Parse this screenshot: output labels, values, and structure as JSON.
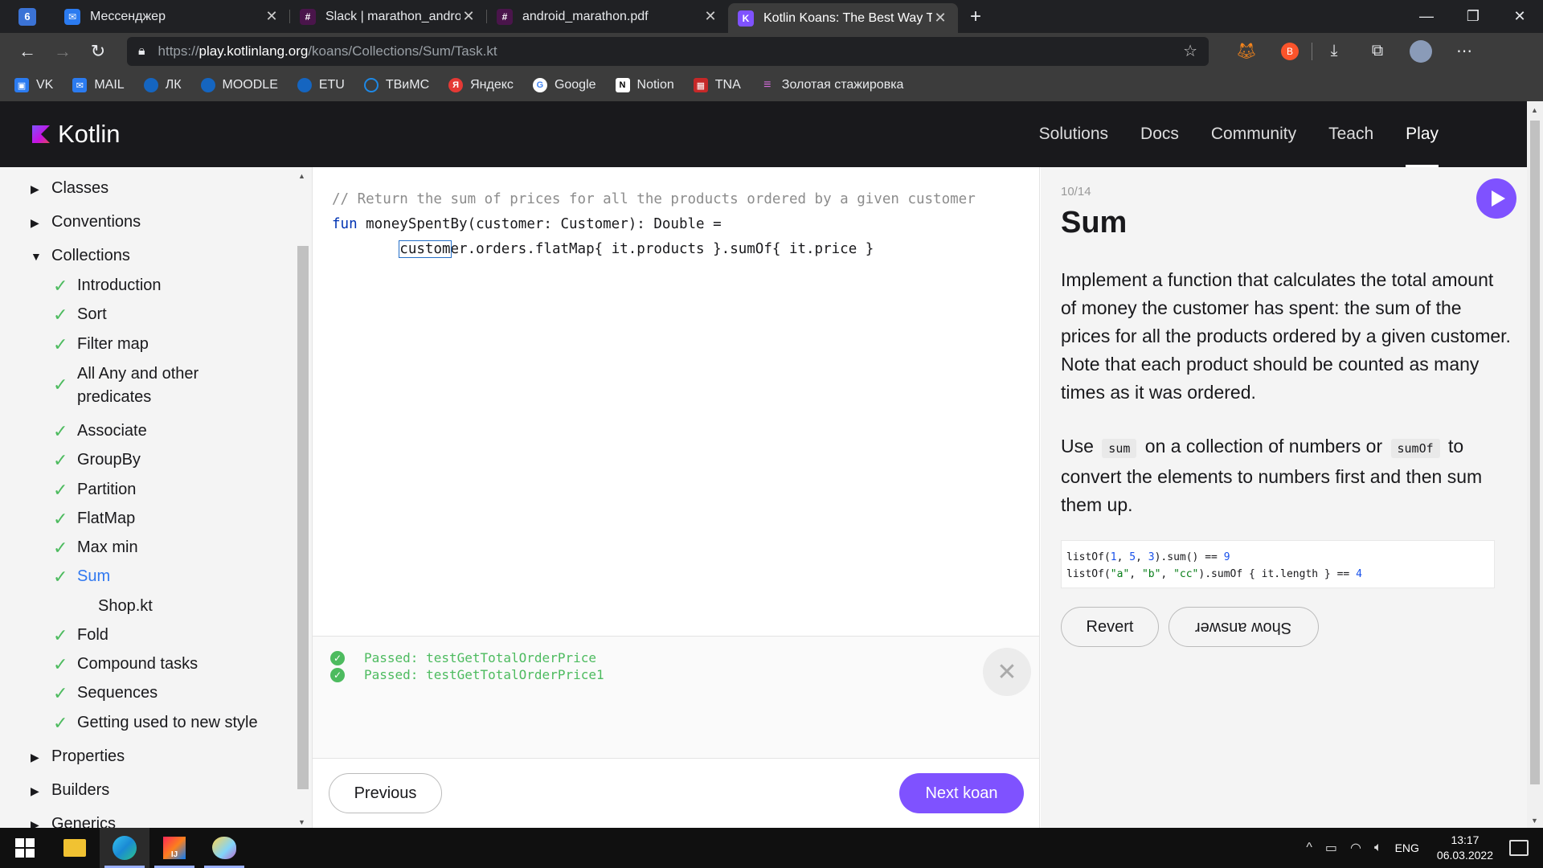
{
  "browser": {
    "tabs": [
      {
        "title": "Мессенджер",
        "icon": "messenger-icon",
        "color": "#2b7bf0",
        "active": false
      },
      {
        "title": "Slack | marathon_android | Vibelab",
        "icon": "slack-icon",
        "color": "#e01e5a",
        "active": false
      },
      {
        "title": "android_marathon.pdf",
        "icon": "slack-icon",
        "color": "#e01e5a",
        "active": false
      },
      {
        "title": "Kotlin Koans: The Best Way To Learn Kotlin",
        "icon": "kotlin-icon",
        "color": "#7f52ff",
        "active": true
      }
    ],
    "url_prefix": "https://",
    "url_host": "play.kotlinlang.org",
    "url_path": "/koans/Collections/Sum/Task.kt",
    "bookmarks": [
      {
        "label": "VK",
        "color": "#2b7bf0"
      },
      {
        "label": "MAIL",
        "color": "#2b7bf0"
      },
      {
        "label": "ЛК",
        "color": "#1565c0"
      },
      {
        "label": "MOODLE",
        "color": "#1565c0"
      },
      {
        "label": "ETU",
        "color": "#1565c0"
      },
      {
        "label": "ТВиМС",
        "color": "#1e88e5"
      },
      {
        "label": "Яндекс",
        "color": "#e53935"
      },
      {
        "label": "Google",
        "color": "#ffffff"
      },
      {
        "label": "Notion",
        "color": "#ffffff"
      },
      {
        "label": "TNA",
        "color": "#c62828"
      },
      {
        "label": "Золотая стажировка",
        "color": "#d26bd8"
      }
    ]
  },
  "site": {
    "logo": "Kotlin",
    "nav": [
      {
        "label": "Solutions",
        "active": false
      },
      {
        "label": "Docs",
        "active": false
      },
      {
        "label": "Community",
        "active": false
      },
      {
        "label": "Teach",
        "active": false
      },
      {
        "label": "Play",
        "active": true
      }
    ]
  },
  "sidebar": {
    "items": [
      {
        "label": "Classes",
        "kind": "section",
        "state": "collapsed"
      },
      {
        "label": "Conventions",
        "kind": "section",
        "state": "collapsed"
      },
      {
        "label": "Collections",
        "kind": "section",
        "state": "expanded"
      },
      {
        "label": "Introduction",
        "kind": "koan",
        "done": true
      },
      {
        "label": "Sort",
        "kind": "koan",
        "done": true
      },
      {
        "label": "Filter map",
        "kind": "koan",
        "done": true
      },
      {
        "label": "All Any and other predicates",
        "kind": "koan",
        "done": true
      },
      {
        "label": "Associate",
        "kind": "koan",
        "done": true
      },
      {
        "label": "GroupBy",
        "kind": "koan",
        "done": true
      },
      {
        "label": "Partition",
        "kind": "koan",
        "done": true
      },
      {
        "label": "FlatMap",
        "kind": "koan",
        "done": true
      },
      {
        "label": "Max min",
        "kind": "koan",
        "done": true
      },
      {
        "label": "Sum",
        "kind": "koan",
        "done": true,
        "current": true
      },
      {
        "label": "Shop.kt",
        "kind": "file"
      },
      {
        "label": "Fold",
        "kind": "koan",
        "done": true
      },
      {
        "label": "Compound tasks",
        "kind": "koan",
        "done": true
      },
      {
        "label": "Sequences",
        "kind": "koan",
        "done": true
      },
      {
        "label": "Getting used to new style",
        "kind": "koan",
        "done": true
      },
      {
        "label": "Properties",
        "kind": "section",
        "state": "collapsed"
      },
      {
        "label": "Builders",
        "kind": "section",
        "state": "collapsed"
      },
      {
        "label": "Generics",
        "kind": "section",
        "state": "collapsed"
      }
    ]
  },
  "editor": {
    "comment": "// Return the sum of prices for all the products ordered by a given customer",
    "line2_kw": "fun",
    "line2_rest": " moneySpentBy(customer: Customer): Double =",
    "line3_sel": "custom",
    "line3_rest": "er.orders.flatMap{ it.products }.sumOf{ it.price }"
  },
  "results": [
    "Passed: testGetTotalOrderPrice",
    "Passed: testGetTotalOrderPrice1"
  ],
  "footer": {
    "previous": "Previous",
    "next": "Next koan"
  },
  "task": {
    "counter": "10/14",
    "title": "Sum",
    "description": "Implement a function that calculates the total amount of money the customer has spent: the sum of the prices for all the products ordered by a given customer. Note that each product should be counted as many times as it was ordered.",
    "use_prefix": "Use",
    "use_code1": "sum",
    "use_mid": "on a collection of numbers or",
    "use_code2": "sumOf",
    "use_suffix": "to convert the elements to numbers first and then sum them up.",
    "sample": {
      "l1_a": "listOf(",
      "l1_n1": "1",
      "l1_b": ", ",
      "l1_n2": "5",
      "l1_c": ", ",
      "l1_n3": "3",
      "l1_d": ").sum() == ",
      "l1_n4": "9",
      "l2_a": "listOf(",
      "l2_s1": "\"a\"",
      "l2_b": ", ",
      "l2_s2": "\"b\"",
      "l2_c": ", ",
      "l2_s3": "\"cc\"",
      "l2_d": ").sumOf { it.length } == ",
      "l2_n": "4"
    },
    "revert": "Revert",
    "show_answer": "Show answer"
  },
  "taskbar": {
    "lang": "ENG",
    "time": "13:17",
    "date": "06.03.2022"
  }
}
